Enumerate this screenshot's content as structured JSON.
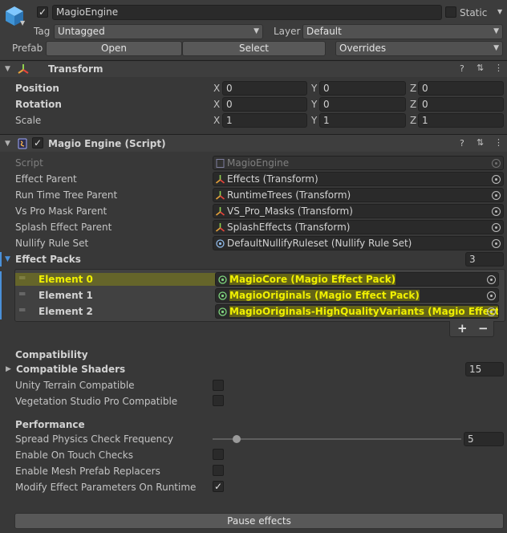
{
  "header": {
    "object_name": "MagioEngine",
    "active": true,
    "static_label": "Static",
    "static": false,
    "tag_label": "Tag",
    "tag_value": "Untagged",
    "layer_label": "Layer",
    "layer_value": "Default",
    "prefab_label": "Prefab",
    "open_label": "Open",
    "select_label": "Select",
    "overrides_label": "Overrides"
  },
  "transform": {
    "title": "Transform",
    "rows": [
      {
        "label": "Position",
        "x": "0",
        "y": "0",
        "z": "0"
      },
      {
        "label": "Rotation",
        "x": "0",
        "y": "0",
        "z": "0"
      },
      {
        "label": "Scale",
        "x": "1",
        "y": "1",
        "z": "1"
      }
    ],
    "axis": {
      "x": "X",
      "y": "Y",
      "z": "Z"
    }
  },
  "script_component": {
    "title": "Magio Engine (Script)",
    "enabled": true,
    "fields": [
      {
        "label": "Script",
        "value": "MagioEngine"
      },
      {
        "label": "Effect Parent",
        "value": "Effects (Transform)"
      },
      {
        "label": "Run Time Tree Parent",
        "value": "RuntimeTrees (Transform)"
      },
      {
        "label": "Vs Pro Mask Parent",
        "value": "VS_Pro_Masks (Transform)"
      },
      {
        "label": "Splash Effect Parent",
        "value": "SplashEffects (Transform)"
      },
      {
        "label": "Nullify Rule Set",
        "value": "DefaultNullifyRuleset (Nullify Rule Set)"
      }
    ],
    "effect_packs": {
      "label": "Effect Packs",
      "count": "3",
      "elements": [
        {
          "label": "Element 0",
          "value": "MagioCore (Magio Effect Pack)"
        },
        {
          "label": "Element 1",
          "value": "MagioOriginals (Magio Effect Pack)"
        },
        {
          "label": "Element 2",
          "value": "MagioOriginals-HighQualityVariants (Magio Effect Pack)"
        }
      ],
      "add": "+",
      "remove": "−"
    },
    "compatibility": {
      "heading": "Compatibility",
      "shaders_label": "Compatible Shaders",
      "shaders_count": "15",
      "unity_terrain_label": "Unity Terrain Compatible",
      "unity_terrain": false,
      "vegetation_label": "Vegetation Studio Pro Compatible",
      "vegetation": false
    },
    "performance": {
      "heading": "Performance",
      "spread_label": "Spread Physics Check Frequency",
      "spread_value": "5",
      "spread_fraction": 0.09,
      "touch_label": "Enable On Touch Checks",
      "touch": false,
      "mesh_label": "Enable Mesh Prefab Replacers",
      "mesh": false,
      "modify_label": "Modify Effect Parameters On Runtime",
      "modify": true
    },
    "pause_label": "Pause effects"
  },
  "icons": {
    "gameobject": "cube-icon",
    "transform": "transform-axes-icon",
    "script": "script-icon",
    "help": "help-icon",
    "preset": "preset-icon",
    "menu": "kebab-menu-icon"
  },
  "colors": {
    "highlight": "#f0f000",
    "accent": "#4a90d9"
  }
}
